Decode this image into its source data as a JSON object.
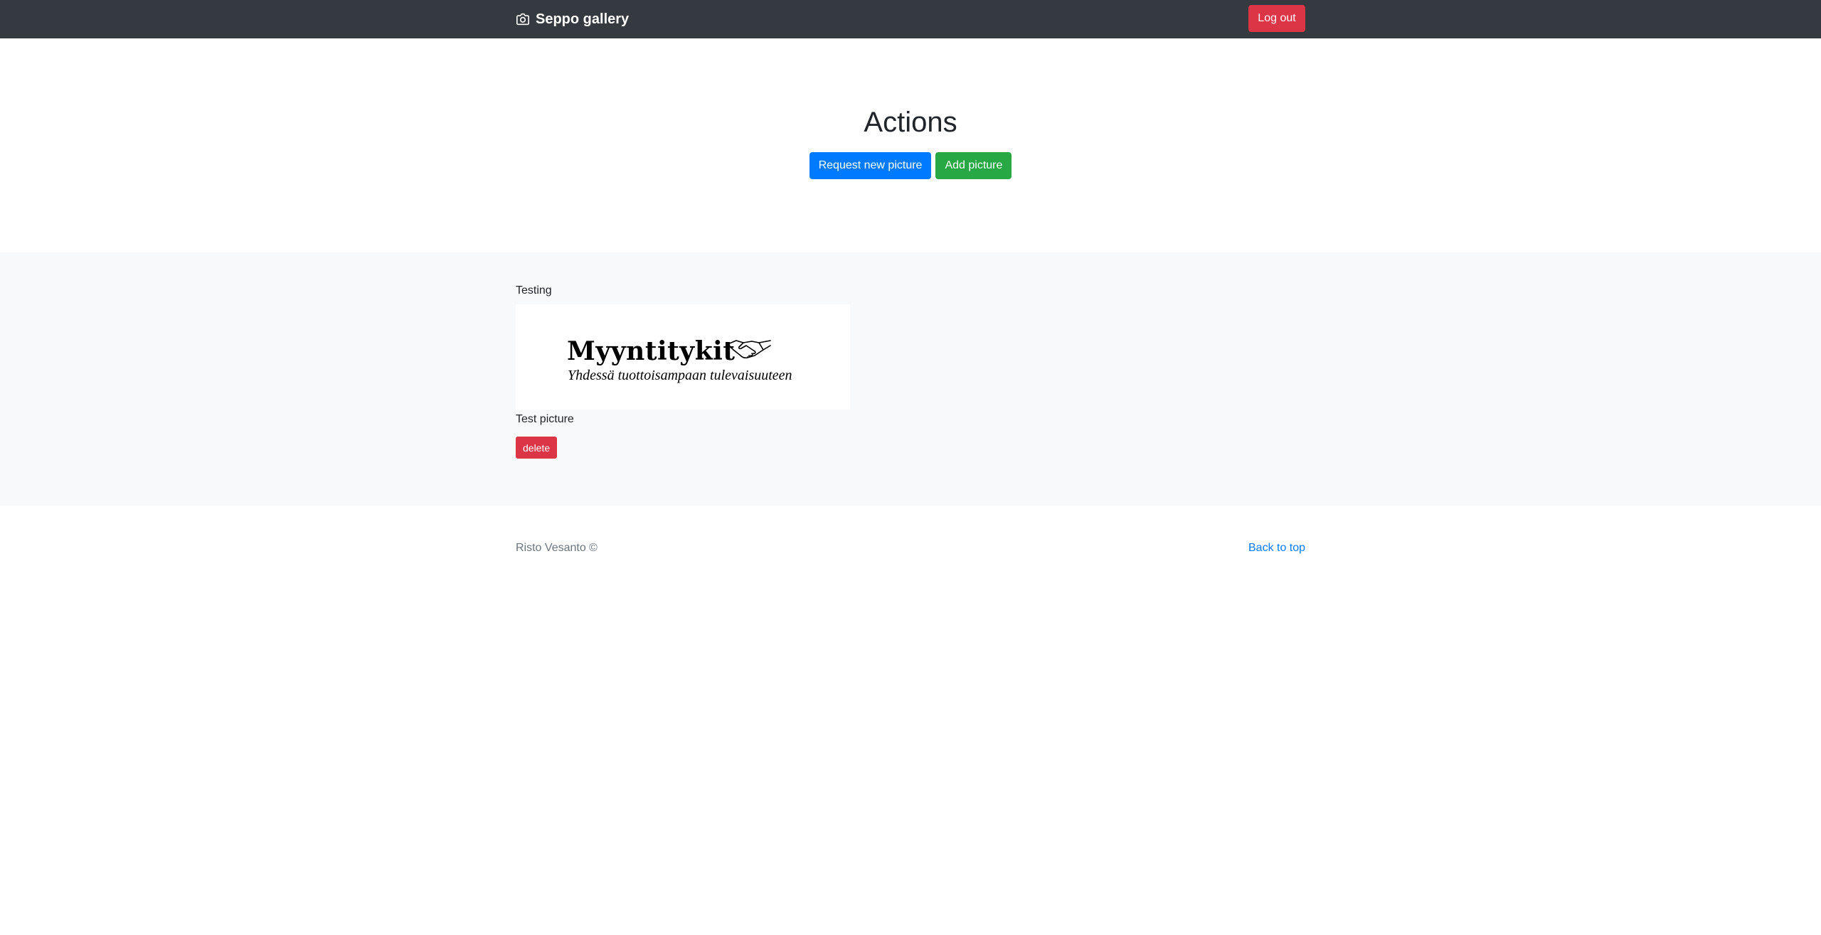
{
  "navbar": {
    "brand_icon": "camera-icon",
    "brand": "Seppo gallery",
    "logout_label": "Log out"
  },
  "hero": {
    "title": "Actions",
    "request_label": "Request new picture",
    "add_label": "Add picture"
  },
  "gallery": {
    "items": [
      {
        "title": "Testing",
        "image": {
          "logo_title": "Myyntitykit",
          "logo_subtitle": "Yhdessä tuottoisampaan tulevaisuuteen",
          "icon": "handshake-icon"
        },
        "caption": "Test picture",
        "delete_label": "delete"
      }
    ]
  },
  "footer": {
    "author": "Risto Vesanto ©",
    "back_to_top": "Back to top"
  },
  "colors": {
    "navbar": "#343a40",
    "danger": "#dc3545",
    "primary": "#007bff",
    "success": "#28a745",
    "album_bg": "#f8f9fa",
    "muted": "#6c757d"
  }
}
